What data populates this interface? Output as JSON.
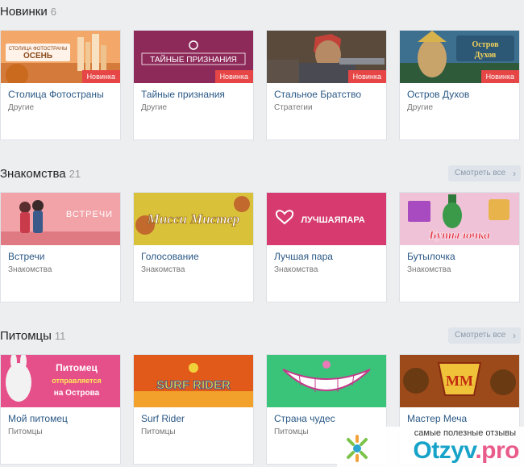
{
  "sections": [
    {
      "title": "Новинки",
      "count": "6",
      "see_all": "",
      "games": [
        {
          "title": "Столица Фотостраны",
          "genre": "Другие",
          "badge": "Новинка",
          "banner_text": "ОСЕНЬ",
          "banner_top": "СТОЛИЦА ФОТОСТРАНЫ"
        },
        {
          "title": "Тайные признания",
          "genre": "Другие",
          "badge": "Новинка",
          "banner_text": "ТАЙНЫЕ ПРИЗНАНИЯ"
        },
        {
          "title": "Стальное Братство",
          "genre": "Стратегии",
          "badge": "Новинка"
        },
        {
          "title": "Остров Духов",
          "genre": "Другие",
          "badge": "Новинка",
          "banner_text": "Остров Духов"
        }
      ]
    },
    {
      "title": "Знакомства",
      "count": "21",
      "see_all": "Смотреть все",
      "games": [
        {
          "title": "Встречи",
          "genre": "Знакомства",
          "banner_text": "ВСТРЕЧИ"
        },
        {
          "title": "Голосование",
          "genre": "Знакомства",
          "banner_text": "Мисси Мистер"
        },
        {
          "title": "Лучшая пара",
          "genre": "Знакомства",
          "banner_text": "ЛУЧШАЯПАРА"
        },
        {
          "title": "Бутылочка",
          "genre": "Знакомства",
          "banner_text": "Бутылочка"
        }
      ]
    },
    {
      "title": "Питомцы",
      "count": "11",
      "see_all": "Смотреть все",
      "games": [
        {
          "title": "Мой питомец",
          "genre": "Питомцы",
          "banner_text": "Питомец отправляется на Острова"
        },
        {
          "title": "Surf Rider",
          "genre": "Питомцы",
          "banner_text": "SURF RIDER"
        },
        {
          "title": "Страна чудес",
          "genre": "Питомцы"
        },
        {
          "title": "Мастер Меча",
          "genre": "",
          "banner_text": "MM"
        }
      ]
    }
  ],
  "watermark": {
    "tagline": "самые полезные отзывы",
    "brand": "Otzyv",
    "brand_suffix": ".pro"
  },
  "colors": {
    "badge": "#e64646",
    "link": "#2a5885",
    "background": "#edeef0"
  }
}
